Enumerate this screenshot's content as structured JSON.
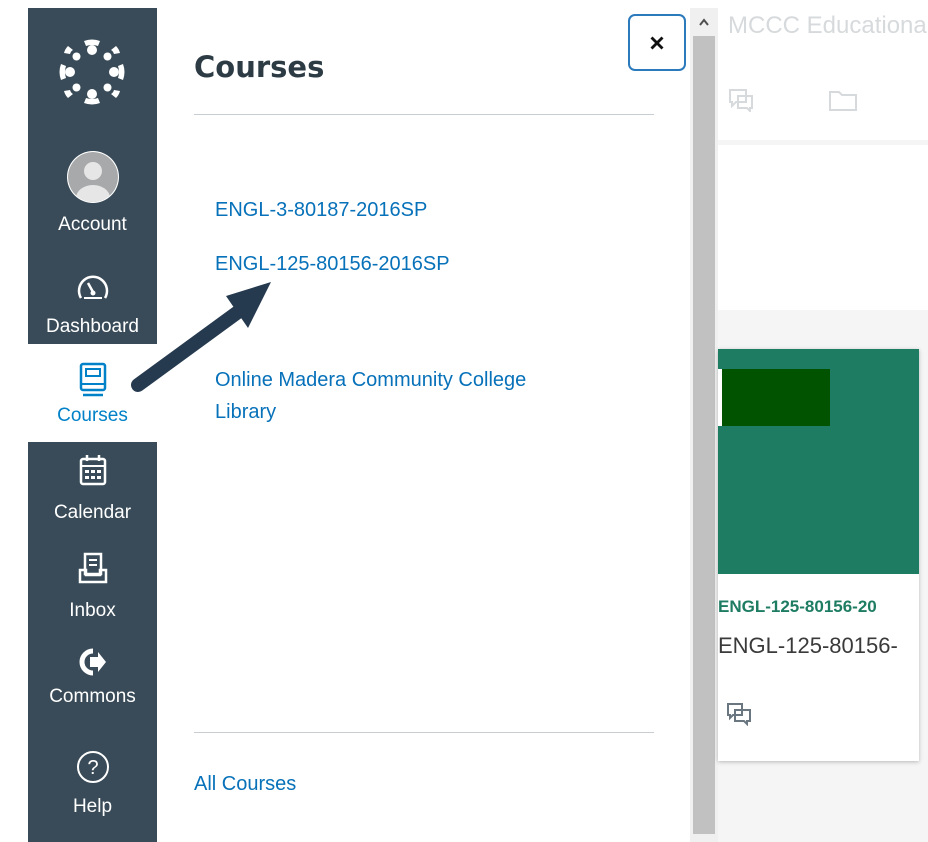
{
  "nav": {
    "items": [
      {
        "label": "Account",
        "icon": "user-avatar-icon"
      },
      {
        "label": "Dashboard",
        "icon": "speedometer-icon"
      },
      {
        "label": "Courses",
        "icon": "book-icon"
      },
      {
        "label": "Calendar",
        "icon": "calendar-icon"
      },
      {
        "label": "Inbox",
        "icon": "inbox-icon"
      },
      {
        "label": "Commons",
        "icon": "commons-arrow-icon"
      },
      {
        "label": "Help",
        "icon": "question-circle-icon"
      }
    ]
  },
  "tray": {
    "title": "Courses",
    "courses": [
      {
        "label": "ENGL-3-80187-2016SP"
      },
      {
        "label": "ENGL-125-80156-2016SP"
      }
    ],
    "groups_line1": "Online Madera Community College",
    "groups_line2": "Library",
    "all_courses": "All Courses",
    "close_label": "×"
  },
  "background": {
    "page_title": "MCCC Educationa",
    "card_code": "ENGL-125-80156-20",
    "card_name": "ENGL-125-80156-"
  },
  "colors": {
    "nav_bg": "#394b58",
    "link": "#0771b9",
    "active_nav_text": "#0081c8",
    "card_color": "#1e7c63",
    "card_stripe": "#015300",
    "arrow": "#263a4f"
  }
}
